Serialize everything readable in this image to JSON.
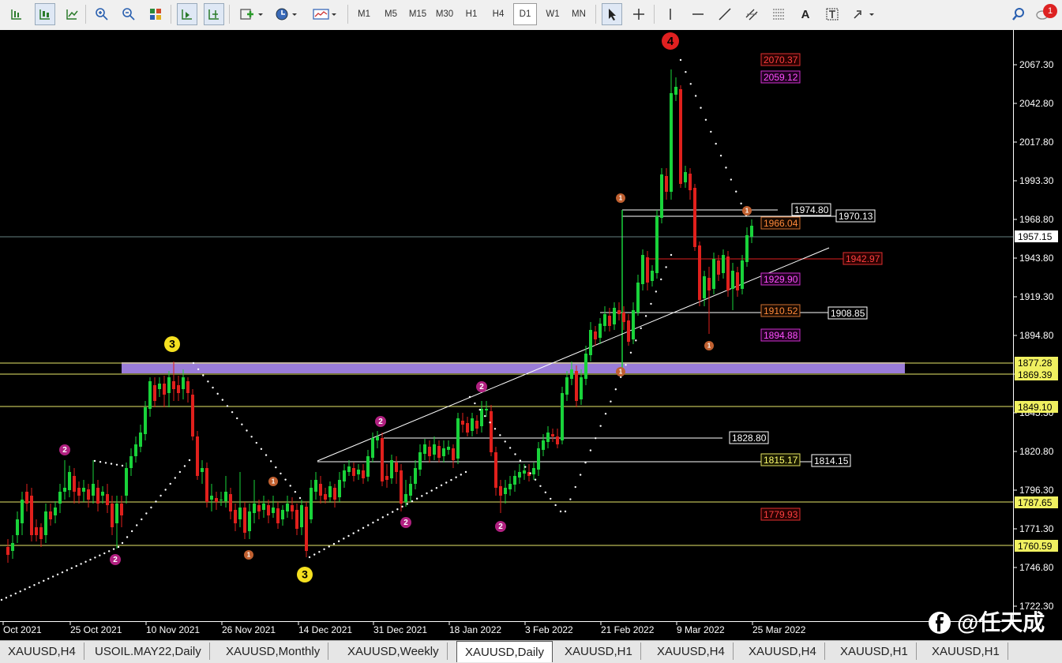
{
  "toolbar": {
    "tools_left": [
      "bar-chart-icon",
      "candlestick-icon",
      "line-chart-icon",
      "zoom-in-icon",
      "zoom-out-icon",
      "tile-windows-icon",
      "autoscroll-icon",
      "chart-shift-icon",
      "indicators-icon",
      "periodicity-icon",
      "templates-icon"
    ],
    "timeframes": [
      "M1",
      "M5",
      "M15",
      "M30",
      "H1",
      "H4",
      "D1",
      "W1",
      "MN"
    ],
    "active_timeframe": "D1",
    "draw_tools": [
      "cursor-icon",
      "crosshair-icon",
      "vertical-line-icon",
      "horizontal-line-icon",
      "trendline-icon",
      "equidistant-channel-icon",
      "fibonacci-icon",
      "text-icon",
      "text-label-icon",
      "arrows-icon"
    ],
    "notification_count": "1"
  },
  "chart": {
    "background": "#000000",
    "bull_color": "#19d33a",
    "bear_color": "#e0201c",
    "price_axis": [
      "2067.30",
      "2042.80",
      "2017.80",
      "1993.30",
      "1968.80",
      "1943.80",
      "1919.30",
      "1894.80",
      "1869.80",
      "1845.30",
      "1820.80",
      "1796.30",
      "1771.30",
      "1746.80",
      "1722.30"
    ],
    "time_axis": [
      "Oct 2021",
      "25 Oct 2021",
      "10 Nov 2021",
      "26 Nov 2021",
      "14 Dec 2021",
      "31 Dec 2021",
      "18 Jan 2022",
      "3 Feb 2022",
      "21 Feb 2022",
      "9 Mar 2022",
      "25 Mar 2022"
    ],
    "current_price": "1957.15",
    "price_tags": [
      {
        "text": "1877.28",
        "style": "yellow"
      },
      {
        "text": "1869.39",
        "style": "yellow"
      },
      {
        "text": "1849.10",
        "style": "yellow"
      },
      {
        "text": "1787.65",
        "style": "yellow"
      },
      {
        "text": "1760.59",
        "style": "yellow"
      },
      {
        "text": "1957.15",
        "style": "white"
      }
    ],
    "in_chart_labels": [
      {
        "text": "2070.37",
        "style": "red"
      },
      {
        "text": "2059.12",
        "style": "magenta"
      },
      {
        "text": "1974.80",
        "style": "white"
      },
      {
        "text": "1970.13",
        "style": "white"
      },
      {
        "text": "1966.04",
        "style": "orange"
      },
      {
        "text": "1942.97",
        "style": "red"
      },
      {
        "text": "1929.90",
        "style": "magenta"
      },
      {
        "text": "1910.52",
        "style": "orange"
      },
      {
        "text": "1908.85",
        "style": "white"
      },
      {
        "text": "1894.88",
        "style": "magenta"
      },
      {
        "text": "1828.80",
        "style": "white"
      },
      {
        "text": "1815.17",
        "style": "yellow"
      },
      {
        "text": "1814.15",
        "style": "white"
      },
      {
        "text": "1779.93",
        "style": "red"
      }
    ],
    "wave_labels": [
      "4",
      "3",
      "3",
      "1",
      "1",
      "1",
      "1",
      "1",
      "1",
      "2",
      "2",
      "2",
      "2",
      "2",
      "2"
    ],
    "watermark": "@任天成"
  },
  "tabs": [
    "XAUUSD,H4",
    "USOIL.MAY22,Daily",
    "XAUUSD,Monthly",
    "XAUUSD,Weekly",
    "XAUUSD,Daily",
    "XAUUSD,H1",
    "XAUUSD,H4",
    "XAUUSD,H4",
    "XAUUSD,H1",
    "XAUUSD,H1"
  ],
  "active_tab": "XAUUSD,Daily"
}
